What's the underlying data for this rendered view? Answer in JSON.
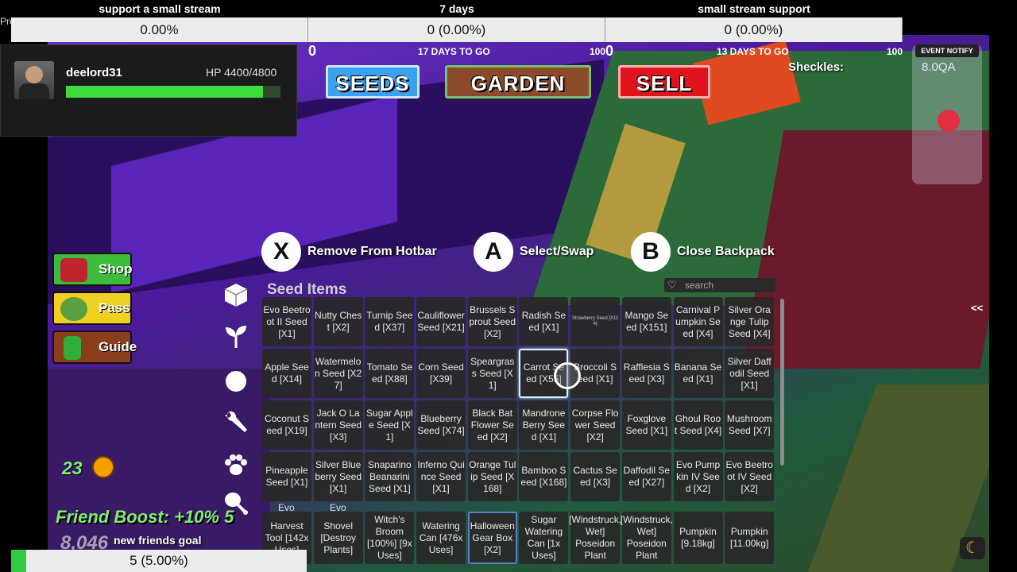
{
  "stream": {
    "partial_left": "Pre",
    "bars": [
      {
        "title": "support a small stream",
        "value": "0.00%"
      },
      {
        "title": "7 days",
        "value": "0 (0.00%)"
      },
      {
        "title": "small stream support",
        "value": "0 (0.00%)"
      }
    ],
    "ticks": [
      {
        "start": "0",
        "label": "17 DAYS TO GO",
        "end": "100"
      },
      {
        "start": "0",
        "label": "13 DAYS TO GO",
        "end": "100"
      }
    ],
    "bottom_goal": {
      "label": "new friends goal",
      "value": "5 (5.00%)",
      "progress": 0.05
    }
  },
  "player": {
    "name": "deelord31",
    "hp": "HP 4400/4800",
    "hp_fraction": 0.917
  },
  "top_buttons": {
    "seeds": "SEEDS",
    "garden": "GARDEN",
    "sell": "SELL"
  },
  "currency": {
    "label": "Sheckles:",
    "value": "8.0QA"
  },
  "event_notify": "EVENT NOTIFY",
  "side_buttons": {
    "shop": "Shop",
    "pass": "Pass",
    "guide": "Guide"
  },
  "hints": [
    {
      "key": "X",
      "label": "Remove From Hotbar"
    },
    {
      "key": "A",
      "label": "Select/Swap"
    },
    {
      "key": "B",
      "label": "Close Backpack"
    }
  ],
  "inventory": {
    "title": "Seed Items",
    "search_placeholder": "search",
    "items": [
      "Evo Beetroot II Seed [X1]",
      "Nutty Chest [X2]",
      "Turnip Seed [X37]",
      "Cauliflower Seed [X21]",
      "Brussels Sprout Seed [X2]",
      "Radish Seed [X1]",
      "Strawberry Seed [X114]",
      "Mango Seed [X151]",
      "Carnival Pumpkin Seed [X4]",
      "Silver Orange Tulip Seed [X4]",
      "Apple Seed [X14]",
      "Watermelon Seed [X27]",
      "Tomato Seed [X88]",
      "Corn Seed [X39]",
      "Speargrass Seed [X1]",
      "Carrot Seed [X55]",
      "Broccoli Seed [X1]",
      "Rafflesia Seed [X3]",
      "Banana Seed [X1]",
      "Silver Daffodil Seed [X1]",
      "Coconut Seed [X19]",
      "Jack O Lantern Seed [X3]",
      "Sugar Apple Seed [X1]",
      "Blueberry Seed [X74]",
      "Black Bat Flower Seed [X2]",
      "Mandrone Berry Seed [X1]",
      "Corpse Flower Seed [X2]",
      "Foxglove Seed [X1]",
      "Ghoul Root Seed [X4]",
      "Mushroom Seed [X7]",
      "Pineapple Seed [X1]",
      "Silver Blueberry Seed [X1]",
      "Snaparino Beanarini Seed [X1]",
      "Inferno Quince Seed [X1]",
      "Orange Tulip Seed [X168]",
      "Bamboo Seed [X168]",
      "Cactus Seed [X3]",
      "Daffodil Seed [X27]",
      "Evo Pumpkin IV Seed [X2]",
      "Evo Beetroot IV Seed [X2]"
    ],
    "partial_row": [
      "Evo",
      "Evo"
    ],
    "selected_index": 15
  },
  "hotbar": [
    "Harvest Tool [142x Uses]",
    "Shovel [Destroy Plants]",
    "Witch's Broom [100%] [9x Uses]",
    "Watering Can [476x Uses]",
    "Halloween Gear Box [X2]",
    "Sugar Watering Can [1x Uses]",
    "[Windstruck, Wet] Poseidon Plant",
    "[Windstruck, Wet] Poseidon Plant",
    "Pumpkin [9.18kg]",
    "Pumpkin [11.00kg]"
  ],
  "friend_boost": "Friend Boost: +10% 5",
  "pumpkin_count": "23",
  "money_partial": "8,046",
  "collapse_label": "<<",
  "colors": {
    "seeds": "#3aa0f0",
    "garden": "#8b4a2a",
    "sell": "#e0141c",
    "shop": "#3dbb3d",
    "pass": "#f0d020",
    "guide": "#8a3e1c",
    "hp": "#3ddc3d"
  }
}
